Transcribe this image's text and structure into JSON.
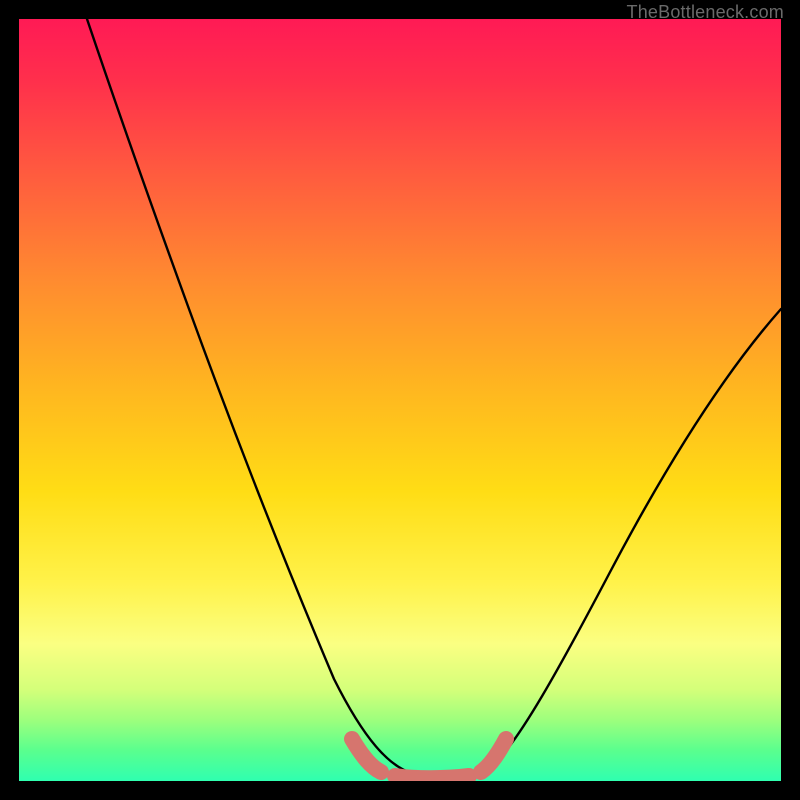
{
  "watermark": {
    "text": "TheBottleneck.com"
  },
  "chart_data": {
    "type": "line",
    "title": "",
    "xlabel": "",
    "ylabel": "",
    "xlim": [
      0,
      100
    ],
    "ylim": [
      0,
      100
    ],
    "grid": false,
    "legend": false,
    "background_gradient": {
      "direction": "vertical",
      "stops": [
        {
          "pos": 0,
          "color": "#ff1a55"
        },
        {
          "pos": 20,
          "color": "#ff5a3f"
        },
        {
          "pos": 48,
          "color": "#ffb520"
        },
        {
          "pos": 74,
          "color": "#fff24a"
        },
        {
          "pos": 88,
          "color": "#d4ff7a"
        },
        {
          "pos": 100,
          "color": "#2fffb0"
        }
      ]
    },
    "series": [
      {
        "name": "bottleneck-curve",
        "color": "#000000",
        "x": [
          9,
          12,
          16,
          20,
          25,
          30,
          35,
          40,
          45,
          48,
          50,
          53,
          56,
          58,
          60,
          63,
          66,
          70,
          75,
          80,
          86,
          92,
          100
        ],
        "values": [
          100,
          90,
          78,
          67,
          55,
          43,
          32,
          22,
          12,
          6,
          3,
          1,
          0,
          0,
          0,
          1,
          3,
          7,
          14,
          23,
          34,
          46,
          62
        ]
      },
      {
        "name": "optimal-zone-marker",
        "color": "#d6756e",
        "x": [
          44,
          46,
          48,
          50,
          52,
          54,
          56,
          58,
          60,
          62,
          63
        ],
        "values": [
          6,
          3.5,
          1.8,
          1.0,
          0.6,
          0.4,
          0.4,
          0.6,
          1.2,
          2.4,
          3.5
        ]
      }
    ]
  }
}
